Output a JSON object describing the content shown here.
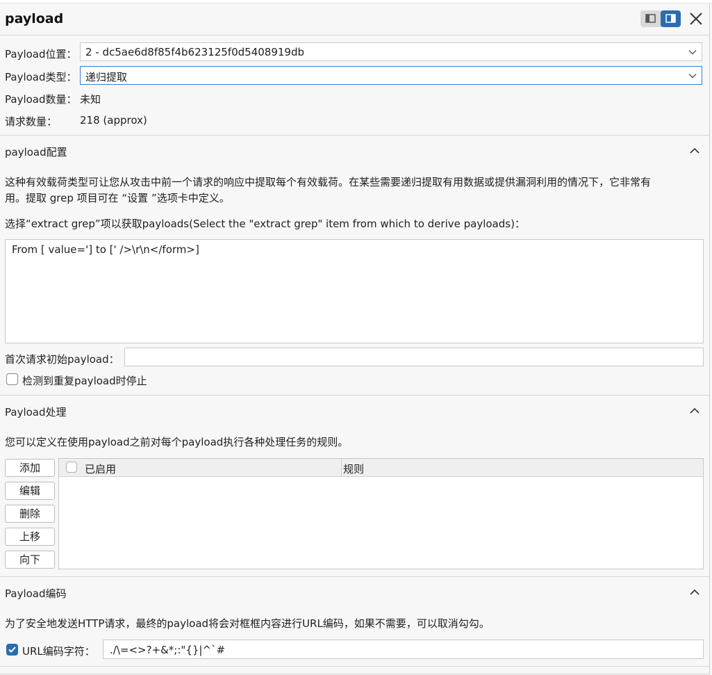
{
  "header": {
    "title": "payload"
  },
  "position": {
    "label": "Payload位置：",
    "value": "2 - dc5ae6d8f85f4b623125f0d5408919db"
  },
  "type": {
    "label": "Payload类型：",
    "value": "递归提取"
  },
  "count": {
    "label": "Payload数量：",
    "value": "未知"
  },
  "requests": {
    "label": "请求数量：",
    "value": "218 (approx)"
  },
  "config": {
    "title": "payload配置",
    "desc_line1": "这种有效载荷类型可让您从攻击中前一个请求的响应中提取每个有效载荷。在某些需要递归提取有用数据或提供漏洞利用的情况下，它非常有",
    "desc_line2": "用。提取 grep 项目可在 “设置 ”选项卡中定义。",
    "select_label": "选择“extract grep”项以获取payloads(Select the \"extract grep\" item from which to derive payloads)：",
    "grep_item": "From [ value='] to [' />\\r\\n</form>]",
    "initial_label": "首次请求初始payload：",
    "initial_value": "",
    "stop_label": "检测到重复payload时停止",
    "stop_checked": false
  },
  "processing": {
    "title": "Payload处理",
    "desc": "您可以定义在使用payload之前对每个payload执行各种处理任务的规则。",
    "buttons": [
      "添加",
      "编辑",
      "删除",
      "上移",
      "向下"
    ],
    "columns": [
      "已启用",
      "规则"
    ],
    "rows": []
  },
  "encoding": {
    "title": "Payload编码",
    "desc": "为了安全地发送HTTP请求，最终的payload将会对框框内容进行URL编码，如果不需要，可以取消勾勾。",
    "checkbox_label": "URL编码字符：",
    "checked": true,
    "chars": "./\\=<>?+&*;:\"{}|^`#"
  },
  "colors": {
    "accent": "#2b6cb0",
    "border": "#c8c8c8",
    "background": "#f7f7f7"
  },
  "icons": {
    "view_toggle": [
      "layout-left-icon",
      "layout-right-icon"
    ],
    "close": "close-icon",
    "chevron": "chevron-down-icon",
    "collapse": "chevron-up-icon"
  }
}
